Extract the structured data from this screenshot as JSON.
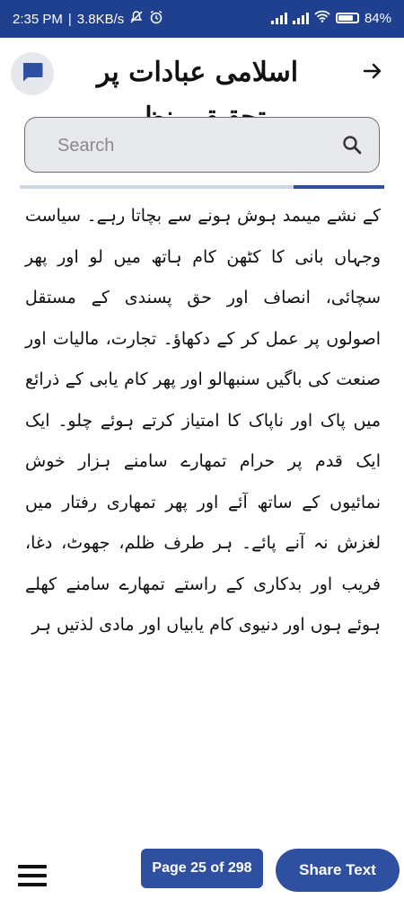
{
  "status_bar": {
    "time": "2:35 PM",
    "separator": "|",
    "net_speed": "3.8KB/s",
    "battery_text": "84",
    "battery_level": 0.84,
    "icons": [
      "muted-notifications-icon",
      "alarm-icon",
      "signal-icon",
      "signal-icon",
      "wifi-icon",
      "battery-icon"
    ]
  },
  "app_bar": {
    "title": "اسلامی عبادات پر تحقیقی نظر",
    "chat_icon": "chat-bubble-icon",
    "back_icon": "arrow-right-icon"
  },
  "search": {
    "placeholder": "Search",
    "value": "",
    "icon": "search-icon"
  },
  "reading_progress": 0.25,
  "content": {
    "text": "کے نشے میںمد ہوش ہونے سے بچاتا رہے۔ سیاست وجہاں بانی کا کٹھن کام ہاتھ میں لو اور پھر سچائی، انصاف اور حق پسندی کے مستقل اصولوں پر عمل کر کے دکھاؤ۔ تجارت، مالیات اور صنعت کی باگیں سنبھالو اور پھر کام یابی کے ذرائع میں پاک اور ناپاک کا امتیاز کرتے ہوئے چلو۔ ایک ایک قدم پر حرام تمھارے سامنے ہزار خوش نمائیوں کے ساتھ آئے اور پھر تمھاری رفتار میں لغزش نہ آنے پائے۔ ہر طرف ظلم، جھوٹ، دغا، فریب اور بدکاری کے راستے تمھارے سامنے کھلے ہوئے ہوں اور دنیوی کام یابیاں اور مادی لذتیں ہر"
  },
  "bottom_bar": {
    "menu_icon": "hamburger-menu-icon",
    "page_label": "Page 25 of 298",
    "share_label": "Share Text"
  },
  "colors": {
    "status_bar": "#1f3f8f",
    "accent": "#2f4fa0",
    "search_bg": "#e8e9ed",
    "progress_track": "#cfd5e2"
  }
}
